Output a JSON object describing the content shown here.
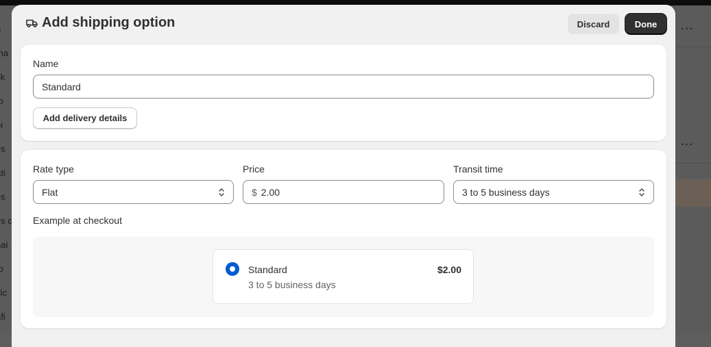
{
  "background": {
    "sidebar_fragments": [
      "g",
      "ma",
      "ck",
      "to",
      "pi",
      "es",
      "ati",
      "es",
      "es c",
      "nai",
      "to",
      "ific",
      "afi"
    ],
    "more_icon": "ellipsis-icon"
  },
  "modal": {
    "icon": "truck-icon",
    "title": "Add shipping option",
    "discard_label": "Discard",
    "done_label": "Done"
  },
  "name_card": {
    "name_label": "Name",
    "name_value": "Standard",
    "add_details_label": "Add delivery details"
  },
  "rate_card": {
    "rate_type_label": "Rate type",
    "rate_type_value": "Flat",
    "price_label": "Price",
    "price_prefix": "$",
    "price_value": "2.00",
    "transit_label": "Transit time",
    "transit_value": "3 to 5 business days",
    "example_label": "Example at checkout",
    "example": {
      "name": "Standard",
      "price": "$2.00",
      "time": "3 to 5 business days"
    }
  },
  "colors": {
    "accent": "#005bd3",
    "primary_button": "#303030",
    "overlay": "#5b5b5b"
  }
}
